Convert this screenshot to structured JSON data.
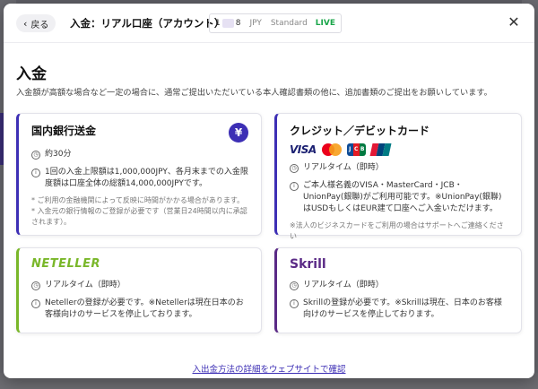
{
  "header": {
    "back_label": "戻る",
    "title": "入金：リアル口座（アカウント）",
    "account_number_start": "1",
    "account_number_end": "8",
    "currency": "JPY",
    "account_type": "Standard",
    "status": "LIVE"
  },
  "page": {
    "heading": "入金",
    "intro": "入金額が高額な場合など一定の場合に、通常ご提出いただいている本人確認書類の他に、追加書類のご提出をお願いしています。",
    "footer_link": "入出金方法の詳細をウェブサイトで確認"
  },
  "methods": {
    "bank": {
      "title": "国内銀行送金",
      "badge_symbol": "¥",
      "time": "約30分",
      "limit": "1回の入金上限額は1,000,000JPY、各月末までの入金限度額は口座全体の総額14,000,000JPYです。",
      "notes": [
        "* ご利用の金融機関によって反映に時間がかかる場合があります。",
        "* 入金元の銀行情報のご登録が必要です（営業日24時間以内に承認されます）。"
      ]
    },
    "card": {
      "title": "クレジット／デビットカード",
      "logos": [
        "visa-logo",
        "mastercard-logo",
        "jcb-logo",
        "unionpay-logo"
      ],
      "visa_text": "VISA",
      "jcb_letters": [
        "J",
        "C",
        "B"
      ],
      "time": "リアルタイム（即時）",
      "info": "ご本人様名義のVISA・MasterCard・JCB・UnionPay(銀聯)がご利用可能です。※UnionPay(銀聯)はUSDもしくはEUR建て口座へご入金いただけます。",
      "note": "※法人のビジネスカードをご利用の場合はサポートへご連絡ください"
    },
    "neteller": {
      "logo_text": "NETELLER",
      "time": "リアルタイム（即時）",
      "info": "Netellerの登録が必要です。※Netellerは現在日本のお客様向けのサービスを停止しております。"
    },
    "skrill": {
      "logo_text": "Skrill",
      "time": "リアルタイム（即時）",
      "info": "Skrillの登録が必要です。※Skrillは現在、日本のお客様向けのサービスを停止しております。"
    }
  },
  "colors": {
    "accent": "#3d2fb5",
    "neteller": "#79b729",
    "skrill": "#5a2a86",
    "live": "#1aa64a"
  }
}
